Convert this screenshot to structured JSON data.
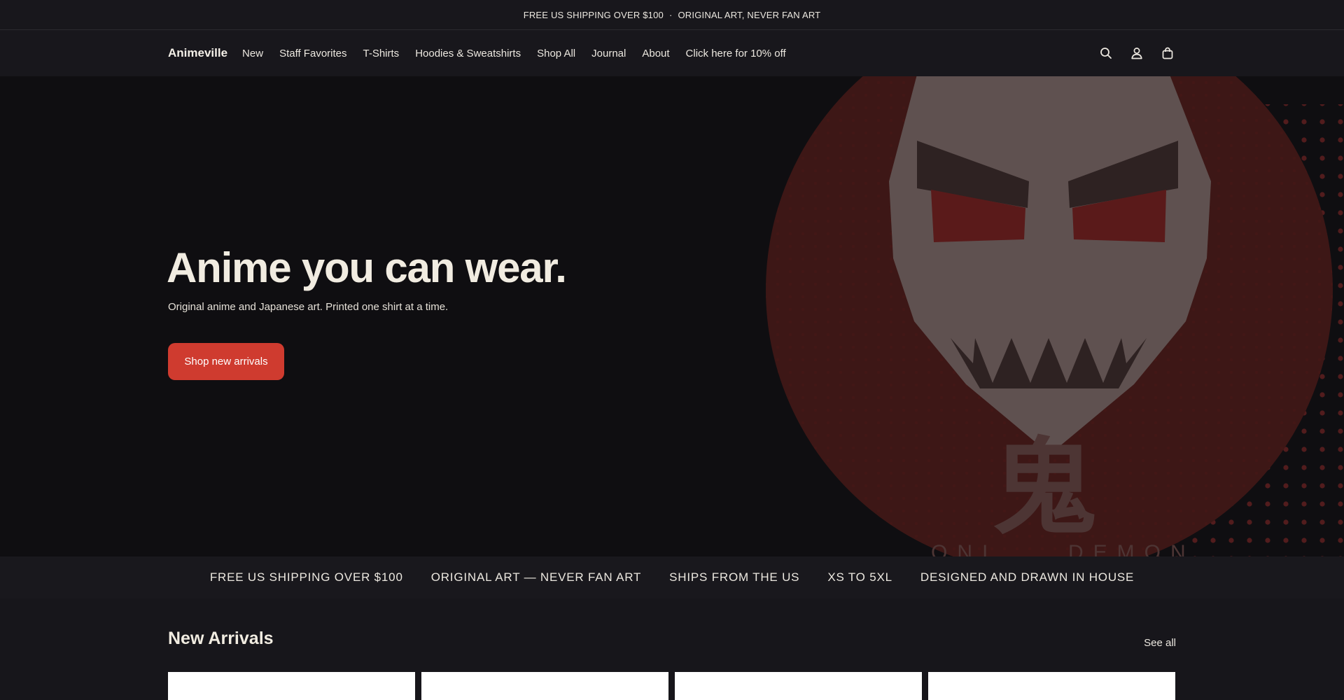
{
  "announcement": {
    "left": "FREE US SHIPPING OVER $100",
    "separator": "·",
    "right": "ORIGINAL ART, NEVER FAN ART"
  },
  "header": {
    "logo": "Animeville",
    "nav": [
      {
        "label": "New"
      },
      {
        "label": "Staff Favorites"
      },
      {
        "label": "T-Shirts"
      },
      {
        "label": "Hoodies & Sweatshirts"
      },
      {
        "label": "Shop All"
      },
      {
        "label": "Journal"
      },
      {
        "label": "About"
      },
      {
        "label": "Click here for 10% off"
      }
    ],
    "icons": [
      "search-icon",
      "account-icon",
      "cart-icon"
    ]
  },
  "hero": {
    "title": "Anime you can wear.",
    "subtitle": "Original anime and Japanese art. Printed one shirt at a time.",
    "cta_label": "Shop new arrivals",
    "art": {
      "kanji": "鬼",
      "caption_left": "ONI",
      "caption_right": "DEMON",
      "colors": {
        "circle": "#3d1716",
        "mask": "#5f5150",
        "eyes": "#5a1a1a",
        "brows": "#2e2222"
      }
    }
  },
  "usp": [
    "FREE US SHIPPING OVER $100",
    "ORIGINAL ART — NEVER FAN ART",
    "SHIPS FROM THE US",
    "XS TO 5XL",
    "DESIGNED AND DRAWN IN HOUSE"
  ],
  "arrivals": {
    "title": "New Arrivals",
    "see_all": "See all"
  },
  "colors": {
    "accent": "#cf3b2f",
    "background": "#17161b",
    "hero_background": "#0f0e11",
    "text": "#ece8e0"
  }
}
